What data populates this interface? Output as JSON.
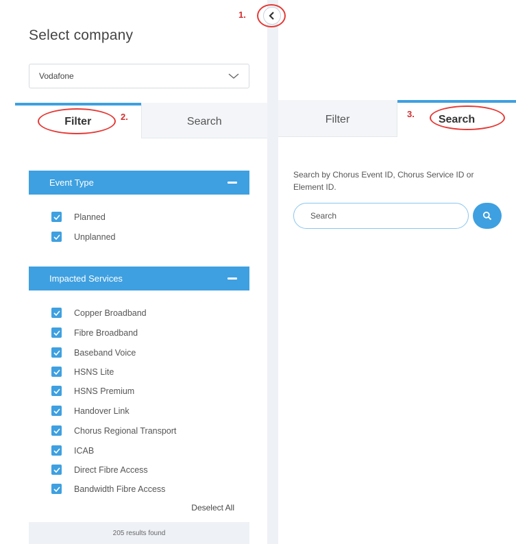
{
  "left_panel": {
    "title": "Select company",
    "company_select": {
      "value": "Vodafone"
    },
    "tabs": [
      "Filter",
      "Search"
    ],
    "event_type": {
      "header": "Event Type",
      "items": [
        {
          "label": "Planned",
          "checked": true
        },
        {
          "label": "Unplanned",
          "checked": true
        }
      ]
    },
    "impacted_services": {
      "header": "Impacted Services",
      "items": [
        {
          "label": "Copper Broadband",
          "checked": true
        },
        {
          "label": "Fibre Broadband",
          "checked": true
        },
        {
          "label": "Baseband Voice",
          "checked": true
        },
        {
          "label": "HSNS Lite",
          "checked": true
        },
        {
          "label": "HSNS Premium",
          "checked": true
        },
        {
          "label": "Handover Link",
          "checked": true
        },
        {
          "label": "Chorus Regional Transport",
          "checked": true
        },
        {
          "label": "ICAB",
          "checked": true
        },
        {
          "label": "Direct Fibre Access",
          "checked": true
        },
        {
          "label": "Bandwidth Fibre Access",
          "checked": true
        }
      ]
    },
    "deselect_label": "Deselect All",
    "results_text": "205 results found"
  },
  "right_panel": {
    "tabs": [
      "Filter",
      "Search"
    ],
    "search_description": "Search by Chorus Event ID, Chorus Service ID or Element ID.",
    "search_placeholder": "Search"
  },
  "annotations": [
    "1.",
    "2.",
    "3."
  ],
  "colors": {
    "accent": "#3ea0e0",
    "annotation": "#e53935"
  }
}
